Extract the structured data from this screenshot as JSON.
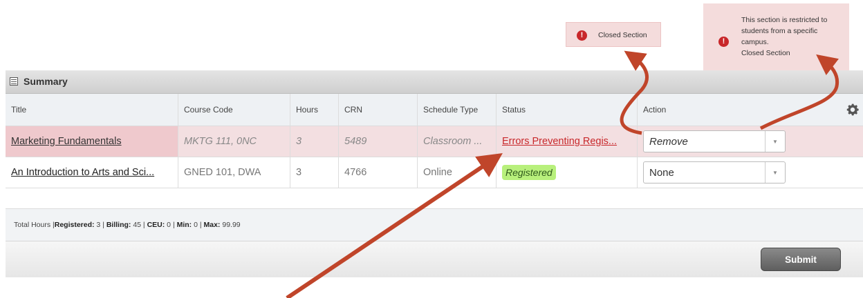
{
  "tooltip_closed": {
    "icon": "error-icon",
    "text": "Closed Section"
  },
  "tooltip_restricted": {
    "icon": "error-icon",
    "lines": [
      "This section is restricted to",
      "students from a specific",
      "campus.",
      "Closed Section"
    ]
  },
  "panel": {
    "title": "Summary",
    "icon": "table-icon"
  },
  "columns": [
    "Title",
    "Course Code",
    "Hours",
    "CRN",
    "Schedule Type",
    "Status",
    "Action"
  ],
  "rows": [
    {
      "title": "Marketing Fundamentals",
      "course_code": "MKTG 111, 0NC",
      "hours": "3",
      "crn": "5489",
      "schedule_type": "Classroom ...",
      "status": "Errors Preventing Regis...",
      "action": "Remove"
    },
    {
      "title": "An Introduction to Arts and Sci...",
      "course_code": "GNED 101, DWA",
      "hours": "3",
      "crn": "4766",
      "schedule_type": "Online",
      "status": "Registered",
      "action": "None"
    }
  ],
  "footer": {
    "total_hours": "Total Hours | ",
    "registered_label": "Registered:",
    "registered_value": " 3 | ",
    "billing_label": "Billing:",
    "billing_value": " 45 | ",
    "ceu_label": "CEU:",
    "ceu_value": " 0 | ",
    "min_label": "Min:",
    "min_value": " 0 | ",
    "max_label": "Max:",
    "max_value": " 99.99"
  },
  "submit_label": "Submit",
  "colors": {
    "error": "#c8272a",
    "arrow": "#c0452a",
    "registered_bg": "#b8f07c"
  }
}
